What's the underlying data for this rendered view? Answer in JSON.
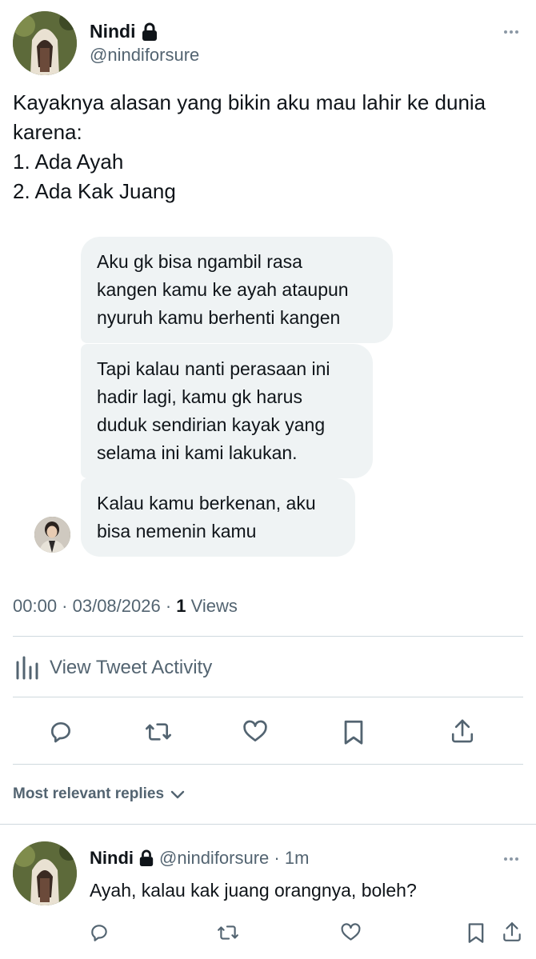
{
  "tweet": {
    "author_name": "Nindi",
    "author_handle": "@nindiforsure",
    "text_line1": "Kayaknya alasan yang bikin aku mau lahir ke dunia",
    "text_line2": "karena:",
    "text_line3": "1. Ada Ayah",
    "text_line4": "2. Ada Kak Juang",
    "time": "00:00 · 03/08/2026 · ",
    "views_count": "1",
    "views_label": " Views"
  },
  "chat": {
    "bubble1": [
      "Aku gk bisa ngambil rasa",
      "kangen kamu ke ayah ataupun",
      "nyuruh kamu berhenti kangen"
    ],
    "bubble2": [
      "Tapi kalau nanti perasaan ini",
      "hadir lagi, kamu gk harus",
      "duduk sendirian kayak yang",
      "selama ini kami lakukan."
    ],
    "bubble3": [
      "Kalau kamu berkenan, aku",
      "bisa nemenin kamu"
    ]
  },
  "activity": {
    "label": "View Tweet Activity"
  },
  "actions": {
    "icons": [
      "reply-icon",
      "retweet-icon",
      "like-icon",
      "bookmark-icon",
      "share-icon"
    ]
  },
  "replies_sort": {
    "label": "Most relevant replies"
  },
  "reply": {
    "author_name": "Nindi",
    "author_handle": "@nindiforsure",
    "time_sep": " · ",
    "time": "1m",
    "text": "Ayah, kalau kak juang orangnya, boleh?"
  },
  "colors": {
    "text": "#0f1419",
    "muted": "#536471",
    "bubble": "#eff3f4",
    "divider": "#cfd9de"
  }
}
